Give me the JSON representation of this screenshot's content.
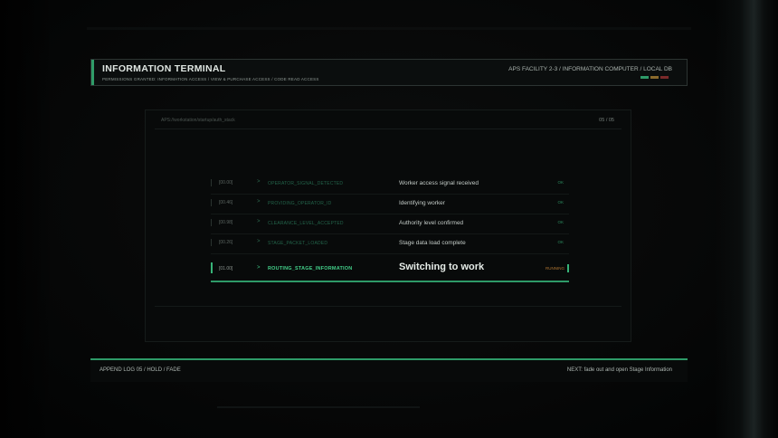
{
  "header": {
    "title": "INFORMATION TERMINAL",
    "permissions": "PERMISSIONS GRANTED: INFORMATION ACCESS / VIEW & PURCHASE ACCESS / CODE READ ACCESS",
    "location": "APS FACILITY 2-3 / INFORMATION COMPUTER / LOCAL DB",
    "status_colors": [
      "#2e9a68",
      "#8a6a2c",
      "#7a2a2a"
    ]
  },
  "panel": {
    "path": "APS://workstation/startup/auth_stack",
    "counter": "05 / 05"
  },
  "log": [
    {
      "time": "[00.00]",
      "arrow": ">",
      "code": "OPERATOR_SIGNAL_DETECTED",
      "desc": "Worker access signal received",
      "state": "OK"
    },
    {
      "time": "[00.46]",
      "arrow": ">",
      "code": "PROVIDING_OPERATOR_ID",
      "desc": "Identifying worker",
      "state": "OK"
    },
    {
      "time": "[00.98]",
      "arrow": ">",
      "code": "CLEARANCE_LEVEL_ACCEPTED",
      "desc": "Authority level confirmed",
      "state": "OK"
    },
    {
      "time": "[00.26]",
      "arrow": ">",
      "code": "STAGE_PACKET_LOADED",
      "desc": "Stage data load complete",
      "state": "OK"
    }
  ],
  "active": {
    "time": "[01.00]",
    "arrow": ">",
    "code": "ROUTING_STAGE_INFORMATION",
    "desc": "Switching to work",
    "state": "RUNNING"
  },
  "footer": {
    "left": "APPEND LOG 05 / HOLD / FADE",
    "right": "NEXT: fade out and open Stage Information"
  }
}
